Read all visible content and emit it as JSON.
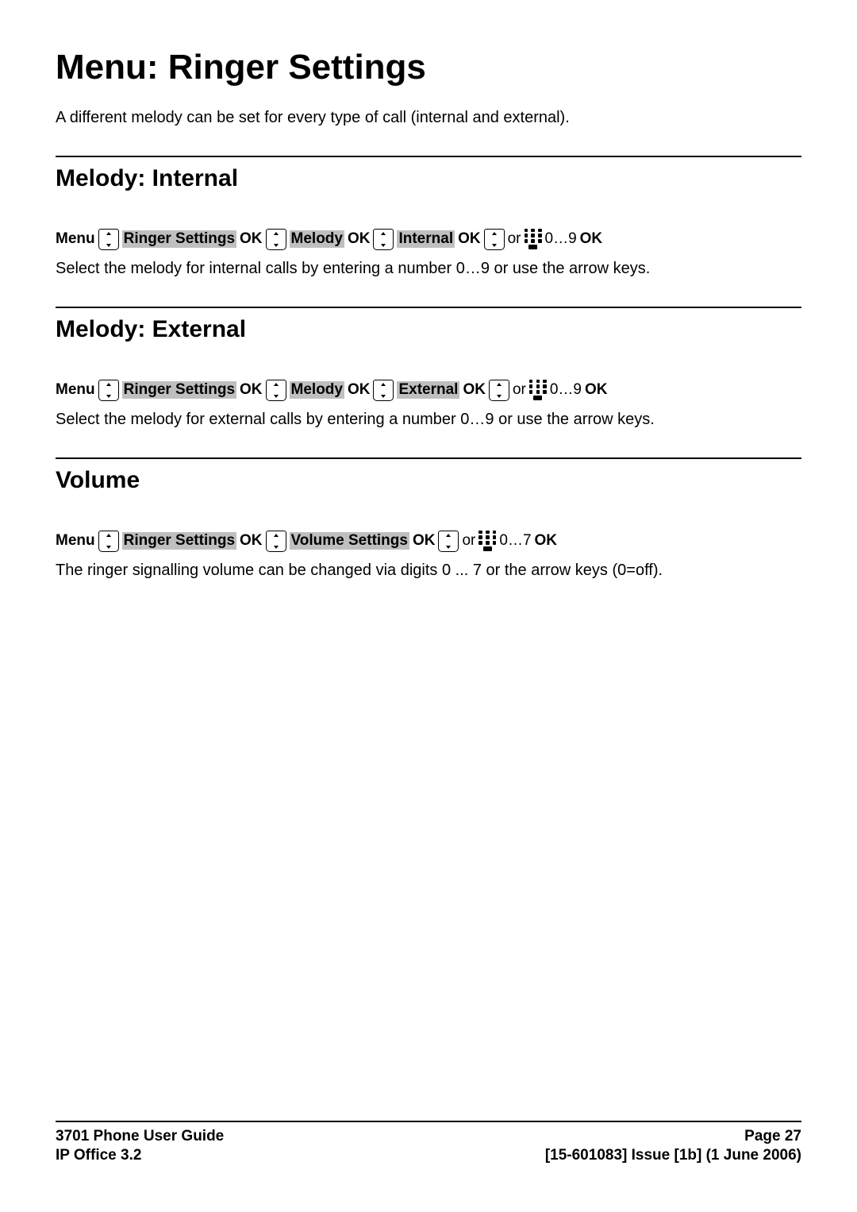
{
  "title": "Menu: Ringer Settings",
  "intro": "A different melody can be set for every type of call (internal and external).",
  "labels": {
    "menu": "Menu",
    "ok": "OK",
    "or": "or",
    "ringer_settings": "Ringer Settings",
    "melody": "Melody",
    "internal": "Internal",
    "external": "External",
    "volume_settings": "Volume Settings",
    "range_0_9": "0…9",
    "range_0_7": "0…7"
  },
  "section1": {
    "title": "Melody: Internal",
    "body": "Select the melody for internal calls by entering a number 0…9 or use the arrow keys."
  },
  "section2": {
    "title": "Melody: External",
    "body": "Select the melody for external calls by entering a number 0…9 or use the arrow keys."
  },
  "section3": {
    "title": "Volume",
    "body": "The ringer signalling volume can be changed via digits 0 ... 7 or the arrow keys (0=off)."
  },
  "footer": {
    "left1": "3701 Phone User Guide",
    "left2": "IP Office 3.2",
    "right1": "Page 27",
    "right2": "[15-601083] Issue [1b] (1 June 2006)"
  }
}
